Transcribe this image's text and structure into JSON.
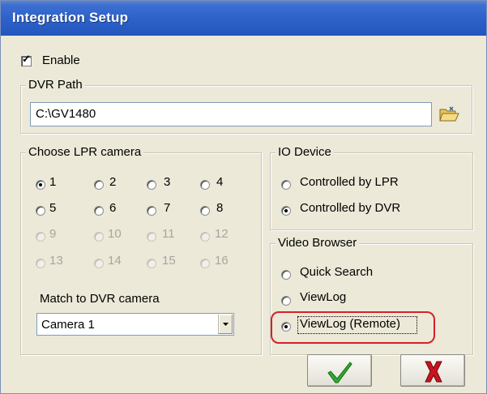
{
  "window": {
    "title": "Integration Setup"
  },
  "enable": {
    "label": "Enable",
    "checked": true
  },
  "dvr_path": {
    "legend": "DVR Path",
    "value": "C:\\GV1480",
    "browse_icon": "folder-open-icon"
  },
  "lpr_camera": {
    "legend": "Choose LPR camera",
    "options": [
      "1",
      "2",
      "3",
      "4",
      "5",
      "6",
      "7",
      "8",
      "9",
      "10",
      "11",
      "12",
      "13",
      "14",
      "15",
      "16"
    ],
    "enabled_count": 8,
    "selected": "1"
  },
  "match_dvr": {
    "label": "Match to DVR camera",
    "selected": "Camera 1"
  },
  "io_device": {
    "legend": "IO Device",
    "options": [
      "Controlled by LPR",
      "Controlled by DVR"
    ],
    "selected": "Controlled by DVR"
  },
  "video_browser": {
    "legend": "Video Browser",
    "options": [
      "Quick Search",
      "ViewLog",
      "ViewLog (Remote)"
    ],
    "selected": "ViewLog (Remote)"
  },
  "buttons": {
    "ok_icon": "green-checkmark-icon",
    "cancel_icon": "red-x-icon"
  },
  "colors": {
    "titlebar": "#2d62c9",
    "dialog_bg": "#ece9d8",
    "highlight": "#d4212a",
    "ok": "#2fa82f",
    "cancel": "#c8141e"
  }
}
